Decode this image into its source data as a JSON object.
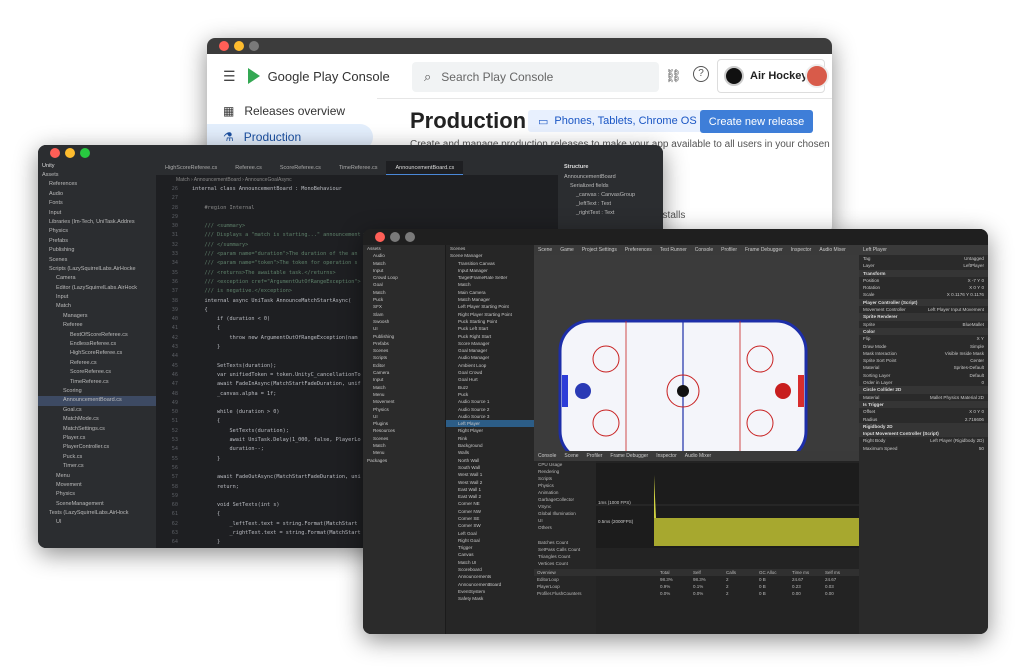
{
  "play_console": {
    "brand": "Google Play Console",
    "search_placeholder": "Search Play Console",
    "app_name": "Air Hockey",
    "nav": [
      "Releases overview",
      "Production"
    ],
    "page_title": "Production",
    "device_chip": "Phones, Tablets, Chrome OS",
    "create_button": "Create new release",
    "description": "Create and manage production releases to make your app available to all users in your chosen",
    "partial_text": "nstalls"
  },
  "ide": {
    "project_label": "Unity",
    "tree": [
      "Assets",
      "References",
      "Audio",
      "Fonts",
      "Input",
      "Libraries (Im-Tech, UniTask.Addres",
      "Physics",
      "Prefabs",
      "Publishing",
      "Scenes",
      "Scripts (LazySquirrelLabs.AirHocke",
      "Camera",
      "Editor (LazySquirrelLabs.AirHock",
      "Input",
      "Match",
      "Managers",
      "Referee",
      "BestOfScoreReferee.cs",
      "EndlessReferee.cs",
      "HighScoreReferee.cs",
      "Referee.cs",
      "ScoreReferee.cs",
      "TimeReferee.cs",
      "Scoring",
      "AnnouncementBoard.cs",
      "Goal.cs",
      "MatchMode.cs",
      "MatchSettings.cs",
      "Player.cs",
      "PlayerController.cs",
      "Puck.cs",
      "Timer.cs",
      "Menu",
      "Movement",
      "Physics",
      "SceneManagement",
      "Tests (LazySquirrelLabs.AirHock",
      "UI"
    ],
    "tabs": [
      "HighScoreReferee.cs",
      "Referee.cs",
      "ScoreReferee.cs",
      "TimeReferee.cs",
      "AnnouncementBoard.cs"
    ],
    "active_tab": "AnnouncementBoard.cs",
    "breadcrumb": "Match  ›  AnnouncementBoard  ›  AnnounceGoalAsync",
    "code_lines": [
      {
        "n": "26",
        "t": "internal class AnnouncementBoard : MonoBehaviour"
      },
      {
        "n": "27",
        "t": ""
      },
      {
        "n": "28",
        "t": "    #region Internal"
      },
      {
        "n": "29",
        "t": ""
      },
      {
        "n": "30",
        "t": "    /// <summary>"
      },
      {
        "n": "31",
        "t": "    /// Displays a \"match is starting...\" announcement w"
      },
      {
        "n": "32",
        "t": "    /// </summary>"
      },
      {
        "n": "33",
        "t": "    /// <param name=\"duration\">The duration of the an"
      },
      {
        "n": "34",
        "t": "    /// <param name=\"token\">The token for operation s"
      },
      {
        "n": "35",
        "t": "    /// <returns>The awaitable task.</returns>"
      },
      {
        "n": "36",
        "t": "    /// <exception cref=\"ArgumentOutOfRangeException\">"
      },
      {
        "n": "37",
        "t": "    /// is negative.</exception>"
      },
      {
        "n": "38",
        "t": "    internal async UniTask AnnounceMatchStartAsync("
      },
      {
        "n": "39",
        "t": "    {"
      },
      {
        "n": "40",
        "t": "        if (duration < 0)"
      },
      {
        "n": "41",
        "t": "        {"
      },
      {
        "n": "42",
        "t": "            throw new ArgumentOutOfRangeException(nam"
      },
      {
        "n": "43",
        "t": "        }"
      },
      {
        "n": "44",
        "t": ""
      },
      {
        "n": "45",
        "t": "        SetTexts(duration);"
      },
      {
        "n": "46",
        "t": "        var unifiedToken = token.UnityC_cancellationTo"
      },
      {
        "n": "47",
        "t": "        await FadeInAsync(MatchStartFadeDuration, unif"
      },
      {
        "n": "48",
        "t": "        _canvas.alpha = 1f;"
      },
      {
        "n": "49",
        "t": ""
      },
      {
        "n": "50",
        "t": "        while (duration > 0)"
      },
      {
        "n": "51",
        "t": "        {"
      },
      {
        "n": "52",
        "t": "            SetTexts(duration);"
      },
      {
        "n": "53",
        "t": "            await UniTask.Delay(1_000, false, PlayerLo"
      },
      {
        "n": "54",
        "t": "            duration--;"
      },
      {
        "n": "55",
        "t": "        }"
      },
      {
        "n": "56",
        "t": ""
      },
      {
        "n": "57",
        "t": "        await FadeOutAsync(MatchStartFadeDuration, uni"
      },
      {
        "n": "58",
        "t": "        return;"
      },
      {
        "n": "59",
        "t": ""
      },
      {
        "n": "60",
        "t": "        void SetTexts(int s)"
      },
      {
        "n": "61",
        "t": "        {"
      },
      {
        "n": "62",
        "t": "            _leftText.text = string.Format(MatchStart"
      },
      {
        "n": "63",
        "t": "            _rightText.text = string.Format(MatchStart"
      },
      {
        "n": "64",
        "t": "        }"
      },
      {
        "n": "65",
        "t": "    }"
      }
    ],
    "structure_title": "Structure",
    "structure": [
      "AnnouncementBoard",
      "Serialized fields",
      "_canvas : CanvasGroup",
      "_leftText : Text",
      "_rightText : Text"
    ]
  },
  "unity": {
    "project_tree": [
      "Assets",
      "Audio",
      "Match",
      "Input",
      "Crowd Loop",
      "Goal",
      "Match",
      "Puck",
      "SFX",
      "Slam",
      "Swoosh",
      "UI",
      "Publishing",
      "Prefabs",
      "Scenes",
      "Scripts",
      "Editor",
      "Camera",
      "Input",
      "Match",
      "Menu",
      "Movement",
      "Physics",
      "UI",
      "Plugins",
      "Resources",
      "Scenes",
      "Match",
      "Menu",
      "Packages"
    ],
    "hierarchy": [
      "Scenes",
      "Scene Manager",
      "Transition Canvas",
      "Input Manager",
      "TargetFrameRate Setter",
      "Match",
      "Main Camera",
      "Match Manager",
      "Left Player Starting Point",
      "Right Player Starting Point",
      "Puck Starting Point",
      "Puck Left Start",
      "Puck Right Start",
      "Score Manager",
      "Goal Manager",
      "Audio Manager",
      "Ambient Loop",
      "Goal Crowd",
      "Goal Hurt",
      "Buzz",
      "Puck",
      "Audio Source 1",
      "Audio Source 2",
      "Audio Source 3",
      "Left Player",
      "Right Player",
      "Rink",
      "Background",
      "Walls",
      "North Wall",
      "South Wall",
      "West Wall 1",
      "West Wall 2",
      "East Wall 1",
      "East Wall 2",
      "Corner NE",
      "Corner NW",
      "Corner SE",
      "Corner SW",
      "Left Goal",
      "Right Goal",
      "Trigger",
      "Canvas",
      "Match UI",
      "Scoreboard",
      "Announcements",
      "AnnouncementBoard",
      "EventSystem",
      "Safety Mask"
    ],
    "profiler_rows": [
      "CPU Usage",
      "Rendering",
      "Scripts",
      "Physics",
      "Animation",
      "GarbageCollector",
      "VSync",
      "Global Illumination",
      "UI",
      "Others"
    ],
    "profiler_stats": [
      "Batches Count",
      "SetPass Calls Count",
      "Triangles Count",
      "Vertices Count"
    ],
    "profiler_tags": [
      "1ms (1000 FPS)",
      "0.5ms (2000FPS)"
    ],
    "profiler_table_headers": [
      "Overview",
      "Total",
      "Self",
      "Calls",
      "GC Alloc",
      "Time ms",
      "Self ms"
    ],
    "profiler_table_rows": [
      {
        "name": "EditorLoop",
        "total": "98.3%",
        "self": "98.3%",
        "calls": "2",
        "gc": "0 B",
        "time": "24.67",
        "selfms": "24.67"
      },
      {
        "name": "PlayerLoop",
        "total": "0.9%",
        "self": "0.1%",
        "calls": "2",
        "gc": "0 B",
        "time": "0.23",
        "selfms": "0.03"
      },
      {
        "name": "Profiler.FlushCounters",
        "total": "0.0%",
        "self": "0.0%",
        "calls": "2",
        "gc": "0 B",
        "time": "0.00",
        "selfms": "0.00"
      }
    ],
    "inspector_title": "Left Player",
    "inspector": [
      {
        "k": "Tag",
        "v": "Untagged"
      },
      {
        "k": "Layer",
        "v": "LeftPlayer"
      },
      {
        "k": "Transform",
        "v": ""
      },
      {
        "k": "Position",
        "v": "X -7  Y 0"
      },
      {
        "k": "Rotation",
        "v": "X 0  Y 0"
      },
      {
        "k": "Scale",
        "v": "X 0.1176  Y 0.1176"
      },
      {
        "k": "Player Controller (Script)",
        "v": ""
      },
      {
        "k": "Movement Controller",
        "v": "Left Player Input Movement"
      },
      {
        "k": "Sprite Renderer",
        "v": ""
      },
      {
        "k": "Sprite",
        "v": "BlueMallet"
      },
      {
        "k": "Color",
        "v": ""
      },
      {
        "k": "Flip",
        "v": "X  Y"
      },
      {
        "k": "Draw Mode",
        "v": "Simple"
      },
      {
        "k": "Mask Interaction",
        "v": "Visible Inside Mask"
      },
      {
        "k": "Sprite Sort Point",
        "v": "Center"
      },
      {
        "k": "Material",
        "v": "Sprites-Default"
      },
      {
        "k": "Sorting Layer",
        "v": "Default"
      },
      {
        "k": "Order in Layer",
        "v": "0"
      },
      {
        "k": "Circle Collider 2D",
        "v": ""
      },
      {
        "k": "Material",
        "v": "Mallet Physics Material 2D"
      },
      {
        "k": "Is Trigger",
        "v": ""
      },
      {
        "k": "Offset",
        "v": "X 0  Y 0"
      },
      {
        "k": "Radius",
        "v": "2.716606"
      },
      {
        "k": "Rigidbody 2D",
        "v": ""
      },
      {
        "k": "Input Movement Controller (Script)",
        "v": ""
      },
      {
        "k": "Right Body",
        "v": "Left Player (Rigidbody 2D)"
      },
      {
        "k": "Maximum Speed",
        "v": "50"
      }
    ],
    "scene_tabs": [
      "Scene",
      "Game",
      "Project Settings",
      "Preferences",
      "Test Runner",
      "Console",
      "Profiler",
      "Frame Debugger",
      "Inspector",
      "Audio Mixer"
    ],
    "console_tabs": [
      "Console",
      "Scene",
      "Profiler",
      "Frame Debugger",
      "Inspector",
      "Audio Mixer"
    ]
  }
}
